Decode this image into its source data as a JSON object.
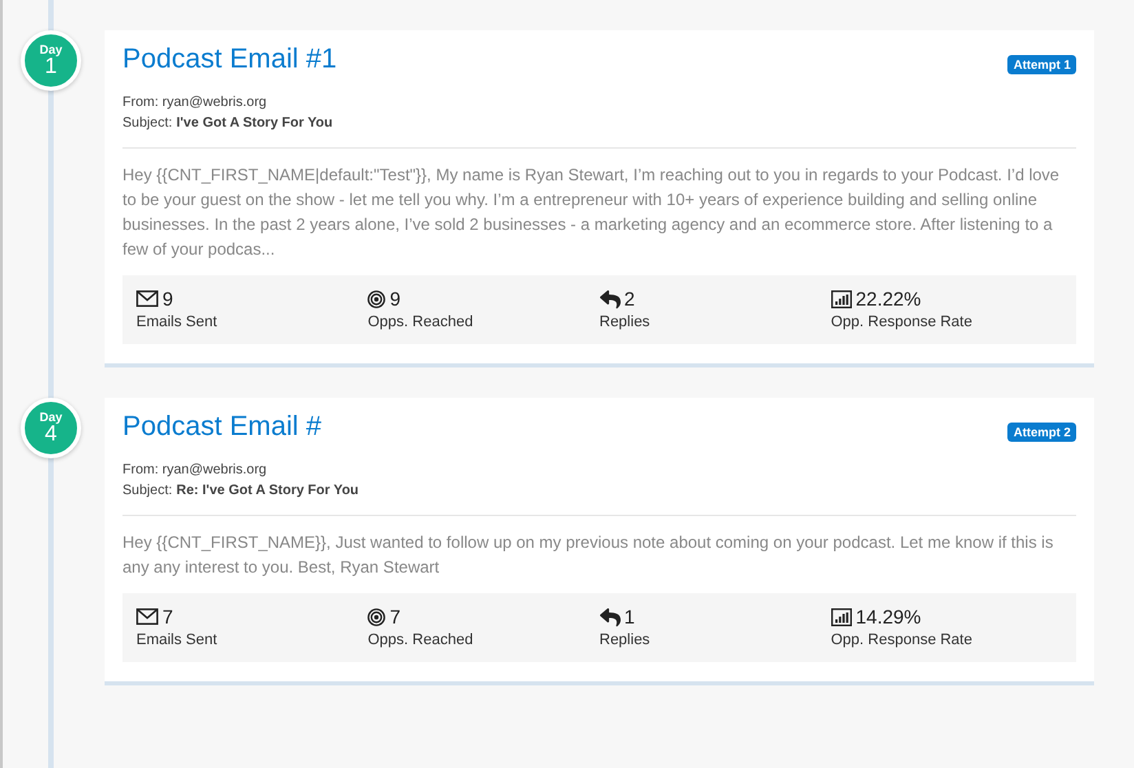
{
  "emails": [
    {
      "day_label": "Day",
      "day": "1",
      "title": "Podcast Email #1",
      "badge": "Attempt 1",
      "from": "From: ryan@webris.org",
      "subject_label": "Subject:",
      "subject": "I've Got A Story For You",
      "body": "Hey {{CNT_FIRST_NAME|default:\"Test\"}}, My name is Ryan Stewart, I’m reaching out to you in regards to your Podcast. I’d love to be your guest on the show - let me tell you why. I’m a entrepreneur with 10+ years of experience building and selling online businesses.  In the past 2 years alone, I’ve sold 2 businesses - a marketing agency and an ecommerce store. After listening to a few of your podcas...",
      "stats": [
        {
          "kind": "sent",
          "value": "9",
          "label": "Emails Sent"
        },
        {
          "kind": "reached",
          "value": "9",
          "label": "Opps. Reached"
        },
        {
          "kind": "replies",
          "value": "2",
          "label": "Replies"
        },
        {
          "kind": "rate",
          "value": "22.22%",
          "label": "Opp. Response Rate"
        }
      ]
    },
    {
      "day_label": "Day",
      "day": "4",
      "title": "Podcast Email #",
      "badge": "Attempt 2",
      "from": "From: ryan@webris.org",
      "subject_label": "Subject:",
      "subject": "Re: I've Got A Story For You",
      "body": "Hey {{CNT_FIRST_NAME}}, Just wanted to follow up on my previous note about coming on your podcast. Let me know if this is any any interest to you. Best, Ryan Stewart",
      "stats": [
        {
          "kind": "sent",
          "value": "7",
          "label": "Emails Sent"
        },
        {
          "kind": "reached",
          "value": "7",
          "label": "Opps. Reached"
        },
        {
          "kind": "replies",
          "value": "1",
          "label": "Replies"
        },
        {
          "kind": "rate",
          "value": "14.29%",
          "label": "Opp. Response Rate"
        }
      ]
    }
  ]
}
